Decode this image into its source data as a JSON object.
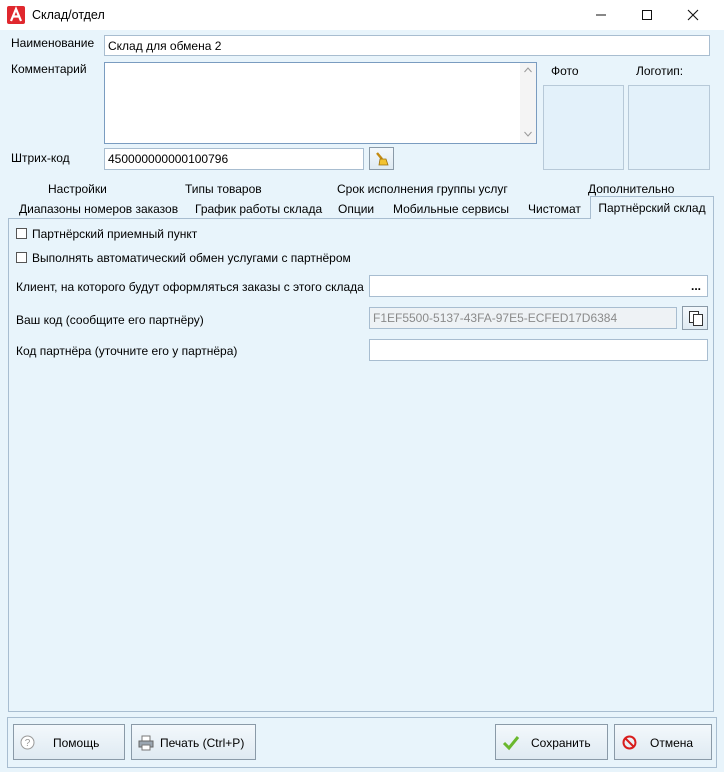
{
  "window": {
    "title": "Склад/отдел"
  },
  "form": {
    "name_label": "Наименование",
    "name_value": "Склад для обмена 2",
    "comment_label": "Комментарий",
    "comment_value": "",
    "barcode_label": "Штрих-код",
    "barcode_value": "450000000000100796",
    "photo_label": "Фото",
    "logo_label": "Логотип:"
  },
  "tabs": {
    "row1": [
      "Настройки",
      "Типы товаров",
      "Срок исполнения группы услуг",
      "Дополнительно"
    ],
    "row2": [
      "Диапазоны номеров заказов",
      "График работы склада",
      "Опции",
      "Мобильные сервисы",
      "Чистомат",
      "Партнёрский склад"
    ],
    "active": "Партнёрский склад"
  },
  "partner": {
    "checkbox1_label": "Партнёрский приемный пункт",
    "checkbox2_label": "Выполнять автоматический обмен услугами с партнёром",
    "client_label": "Клиент, на которого будут оформляться заказы с этого склада",
    "client_value": "",
    "client_browse": "...",
    "your_code_label": "Ваш код (сообщите его партнёру)",
    "your_code_value": "F1EF5500-5137-43FA-97E5-ECFED17D6384",
    "partner_code_label": "Код партнёра (уточните его у партнёра)",
    "partner_code_value": ""
  },
  "buttons": {
    "help": "Помощь",
    "print": "Печать (Ctrl+P)",
    "save": "Сохранить",
    "cancel": "Отмена"
  }
}
